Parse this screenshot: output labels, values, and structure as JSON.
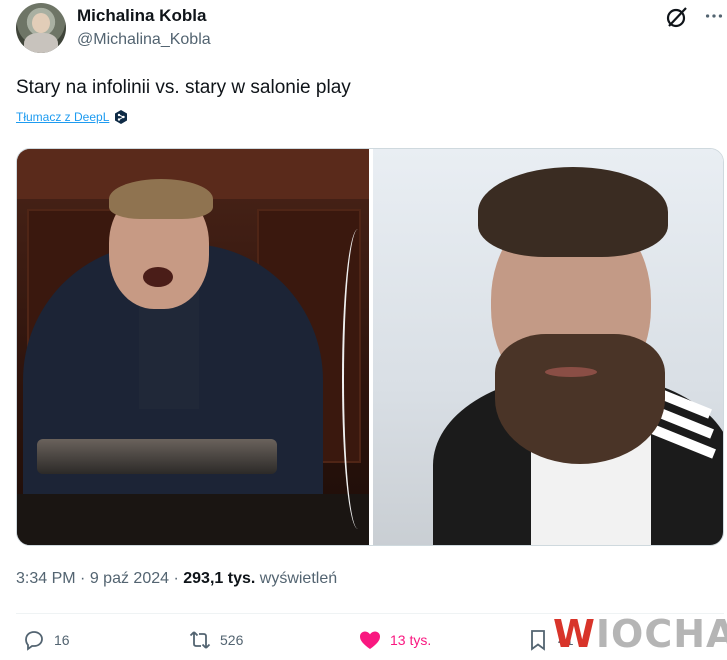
{
  "author": {
    "name": "Michalina Kobla",
    "handle": "@Michalina_Kobla"
  },
  "header_icons": [
    "grok-icon",
    "more-icon"
  ],
  "tweet": {
    "text": "Stary na infolinii vs. stary w salonie play",
    "translate_label": "Tłumacz z DeepL"
  },
  "meta": {
    "time": "3:34 PM",
    "separator": "·",
    "date": "9 paź 2024",
    "views_count": "293,1 tys.",
    "views_label": "wyświetleń"
  },
  "actions": {
    "replies": "16",
    "retweets": "526",
    "likes": "13 tys.",
    "bookmarks": "41"
  },
  "watermark": "WIOCHA",
  "colors": {
    "link": "#1d9bf0",
    "like": "#f91880",
    "secondary_text": "#536471"
  }
}
